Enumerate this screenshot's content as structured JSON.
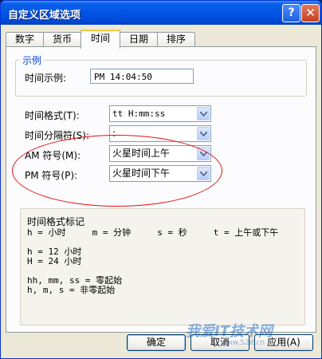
{
  "window": {
    "title": "自定义区域选项",
    "help_label": "?",
    "close_label": "✕"
  },
  "tabs": [
    {
      "label": "数字"
    },
    {
      "label": "货币"
    },
    {
      "label": "时间"
    },
    {
      "label": "日期"
    },
    {
      "label": "排序"
    }
  ],
  "example": {
    "legend": "示例",
    "label": "时间示例:",
    "value": "PM 14:04:50"
  },
  "settings": {
    "format_label": "时间格式(T):",
    "format_value": "tt H:mm:ss",
    "separator_label": "时间分隔符(S):",
    "separator_value": ":",
    "am_label": "AM 符号(M):",
    "am_value": "火星时间上午",
    "pm_label": "PM 符号(P):",
    "pm_value": "火星时间下午"
  },
  "notes": {
    "title": "时间格式标记",
    "line1": "h = 小时     m = 分钟     s = 秒     t = 上午或下午",
    "line2": "h = 12 小时",
    "line3": "H = 24 小时",
    "line4": "hh, mm, ss = 零起始",
    "line5": "h, m, s = 非零起始"
  },
  "buttons": {
    "ok": "确定",
    "cancel": "取消",
    "apply": "应用(A)"
  },
  "watermark": {
    "text": "我爱IT技术网",
    "url": "www.52it.cn"
  },
  "colors": {
    "titlebar": "#0055e5",
    "annotation_circle": "#e01010",
    "legend": "#0046d5"
  }
}
